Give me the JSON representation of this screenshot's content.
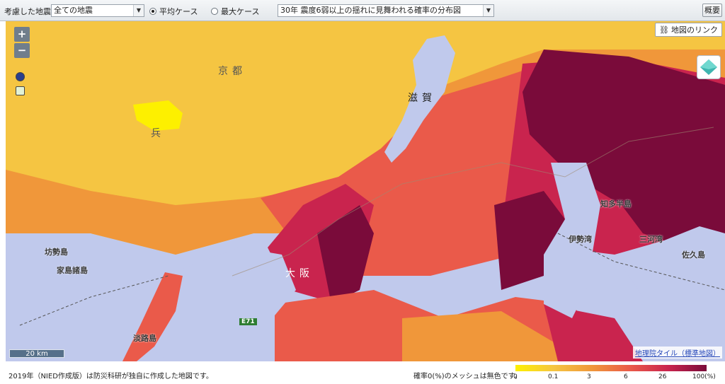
{
  "toolbar": {
    "fault_label": "考慮した地震",
    "fault_selected": "全ての地震",
    "case_average": "平均ケース",
    "case_max": "最大ケース",
    "map_type_selected": "30年 震度6弱以上の揺れに見舞われる確率の分布図",
    "summary_label": "概要",
    "selected_case": "平均ケース"
  },
  "map": {
    "link_label": "地図のリンク",
    "zoom_in": "+",
    "zoom_out": "−",
    "scale_label": "20 km",
    "attribution": "地理院タイル（標準地図）",
    "prefecture_labels": [
      "京",
      "都",
      "兵",
      "滋",
      "賀",
      "大",
      "阪"
    ],
    "place_labels": [
      "坊勢島",
      "家島諸島",
      "淡路島",
      "伊勢湾",
      "三河湾",
      "佐久島",
      "知多半島"
    ],
    "route_shield": "E71"
  },
  "legend": {
    "note": "2019年（NIED作成版）は防災科研が独自に作成した地図です。",
    "mesh_note": "確率0(%)のメッシュは無色です。",
    "ticks": [
      "0",
      "0.1",
      "3",
      "6",
      "26",
      "100(%)"
    ],
    "colors": [
      "#fdf000",
      "#f5c542",
      "#f0973a",
      "#ea5a4a",
      "#c9244e",
      "#7a0b3a"
    ]
  }
}
